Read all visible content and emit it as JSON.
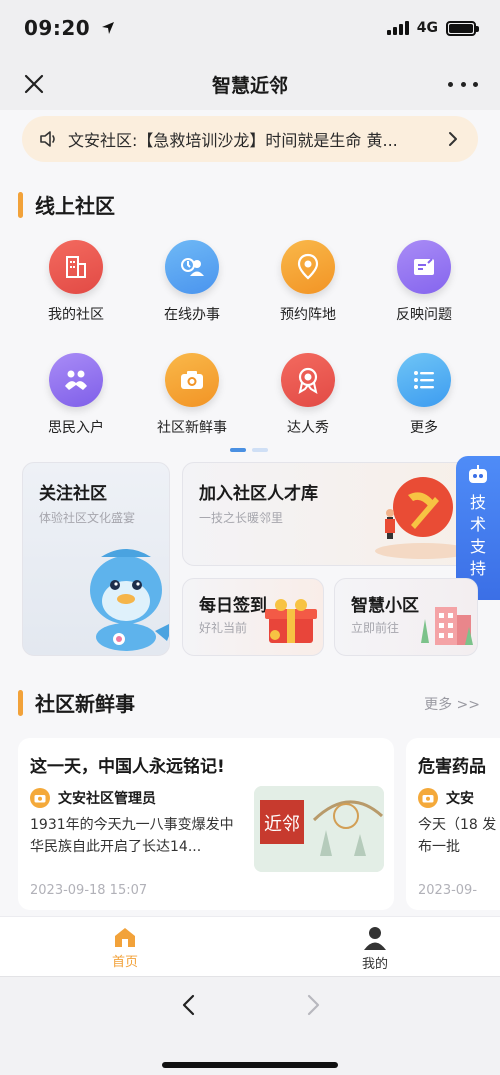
{
  "status_bar": {
    "time": "09:20",
    "network": "4G"
  },
  "nav": {
    "title": "智慧近邻",
    "close_icon": "close-icon",
    "more_icon": "more-icon"
  },
  "notice": {
    "text": "文安社区:【急救培训沙龙】时间就是生命 黄...",
    "icon": "speaker-icon"
  },
  "online_section": {
    "title": "线上社区"
  },
  "grid_items": [
    {
      "label": "我的社区",
      "icon": "building-icon",
      "color_from": "#f36a5f",
      "color_to": "#e24a45"
    },
    {
      "label": "在线办事",
      "icon": "service-icon",
      "color_from": "#6fb9f6",
      "color_to": "#4a94ee"
    },
    {
      "label": "预约阵地",
      "icon": "location-pin-icon",
      "color_from": "#f9b84a",
      "color_to": "#f29425"
    },
    {
      "label": "反映问题",
      "icon": "feedback-icon",
      "color_from": "#a98cf6",
      "color_to": "#8565ee"
    },
    {
      "label": "思民入户",
      "icon": "handshake-icon",
      "color_from": "#a98cf6",
      "color_to": "#7f5fe9"
    },
    {
      "label": "社区新鲜事",
      "icon": "camera-icon",
      "color_from": "#f9b84a",
      "color_to": "#f29425"
    },
    {
      "label": "达人秀",
      "icon": "medal-icon",
      "color_from": "#f36a5f",
      "color_to": "#e24a45"
    },
    {
      "label": "更多",
      "icon": "list-icon",
      "color_from": "#6fc5f6",
      "color_to": "#3d9cf0"
    }
  ],
  "pager": {
    "active_color": "#4a90e2",
    "inactive_color": "#cfdff5"
  },
  "cards": {
    "follow": {
      "title": "关注社区",
      "subtitle": "体验社区文化盛宴"
    },
    "talent": {
      "title": "加入社区人才库",
      "subtitle": "一技之长暖邻里"
    },
    "checkin": {
      "title": "每日签到",
      "subtitle": "好礼当前"
    },
    "smart": {
      "title": "智慧小区",
      "subtitle": "立即前往"
    }
  },
  "tech_support": {
    "label": "技术支持",
    "icon": "robot-icon"
  },
  "news_section": {
    "title": "社区新鲜事",
    "more": "更多 >>"
  },
  "news": [
    {
      "title": "这一天，中国人永远铭记!",
      "author": "文安社区管理员",
      "summary": "1931年的今天九一八事变爆发中华民族自此开启了长达14...",
      "date": "2023-09-18 15:07",
      "thumb_text": "近邻"
    },
    {
      "title": "危害药品",
      "author": "文安",
      "summary": "今天（18 发布一批",
      "date": "2023-09-"
    }
  ],
  "tabbar": [
    {
      "label": "首页",
      "icon": "home-icon",
      "active": true
    },
    {
      "label": "我的",
      "icon": "user-icon",
      "active": false
    }
  ],
  "colors": {
    "accent": "#f2a23a",
    "active_tab": "#f2a23a",
    "tech_blue": "#3b6fe6"
  }
}
